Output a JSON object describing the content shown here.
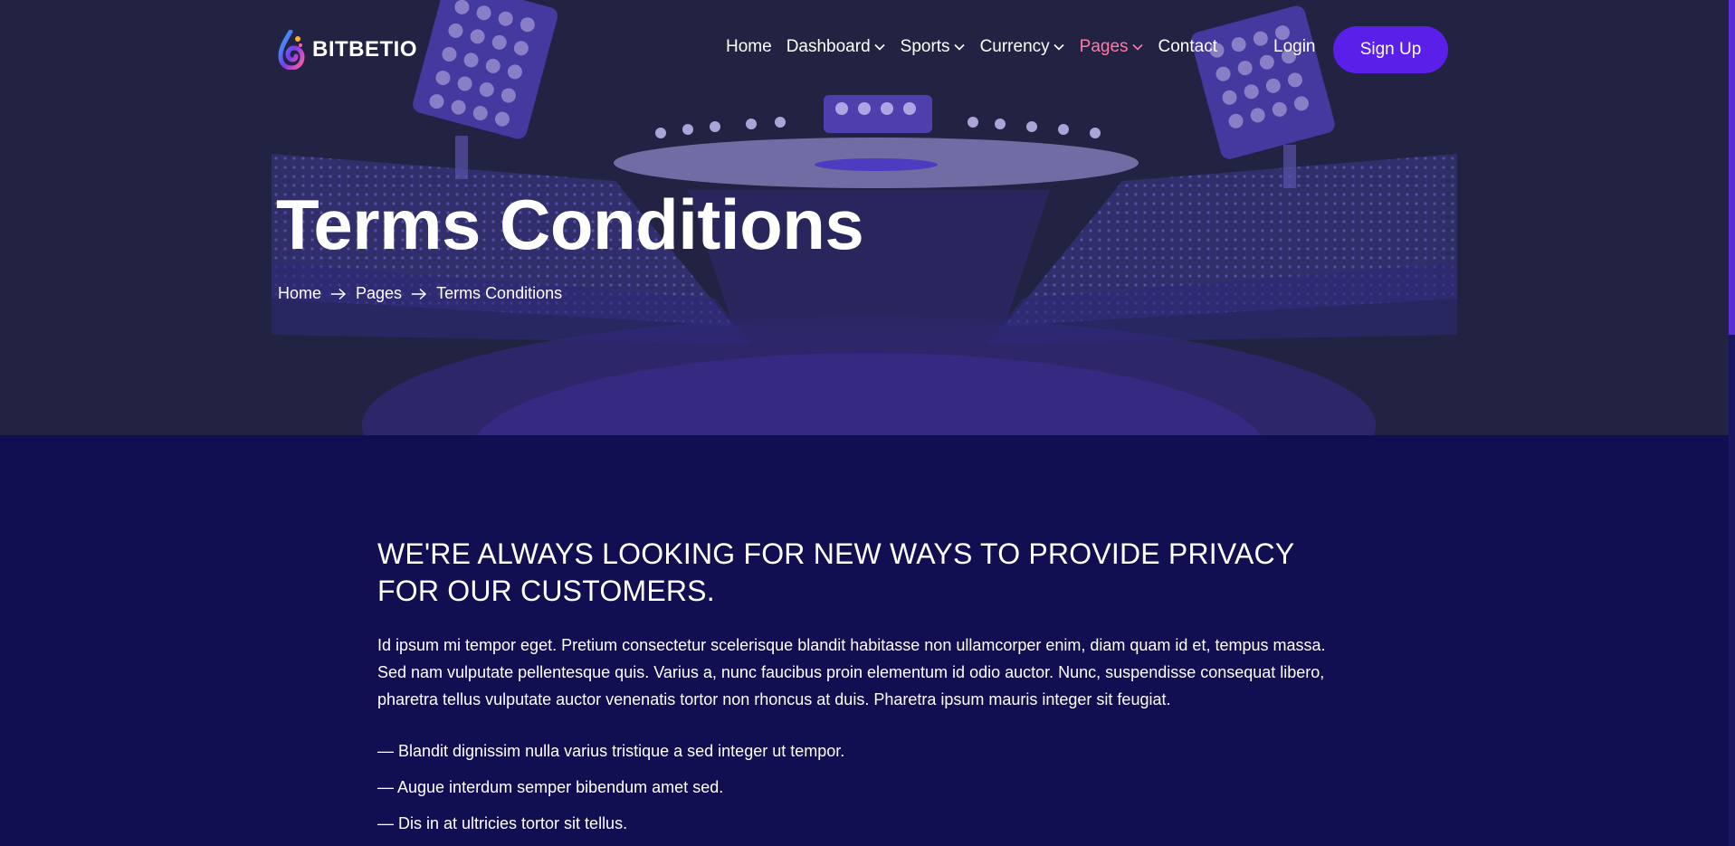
{
  "brand": {
    "name": "BITBETIO"
  },
  "nav": {
    "items": [
      {
        "label": "Home",
        "has_dropdown": false,
        "active": false
      },
      {
        "label": "Dashboard",
        "has_dropdown": true,
        "active": false
      },
      {
        "label": "Sports",
        "has_dropdown": true,
        "active": false
      },
      {
        "label": "Currency",
        "has_dropdown": true,
        "active": false
      },
      {
        "label": "Pages",
        "has_dropdown": true,
        "active": true
      },
      {
        "label": "Contact",
        "has_dropdown": false,
        "active": false
      }
    ],
    "login_label": "Login",
    "signup_label": "Sign Up"
  },
  "hero": {
    "title": "Terms Conditions",
    "breadcrumb": [
      "Home",
      "Pages",
      "Terms Conditions"
    ]
  },
  "content": {
    "heading": "WE'RE ALWAYS LOOKING FOR NEW WAYS TO PROVIDE PRIVACY FOR OUR CUSTOMERS.",
    "paragraph": "Id ipsum mi tempor eget. Pretium consectetur scelerisque blandit habitasse non ullamcorper enim, diam quam id et, tempus massa. Sed nam vulputate pellentesque quis. Varius a, nunc faucibus proin elementum id odio auctor. Nunc, suspendisse consequat libero, pharetra tellus vulputate auctor venenatis tortor non rhoncus at duis. Pharetra ipsum mauris integer sit feugiat.",
    "list": [
      "— Blandit dignissim nulla varius tristique a sed integer ut tempor.",
      "— Augue interdum semper bibendum amet sed.",
      "— Dis in at ultricies tortor sit tellus."
    ]
  },
  "colors": {
    "hero_bg": "#222343",
    "page_bg": "#120e52",
    "accent": "#5a1fe8",
    "active_nav": "#ff7aa8"
  },
  "icons": {
    "logo": "flame-drop-logo-icon",
    "dropdown": "chevron-down-icon",
    "breadcrumb_separator": "arrow-right-icon"
  }
}
